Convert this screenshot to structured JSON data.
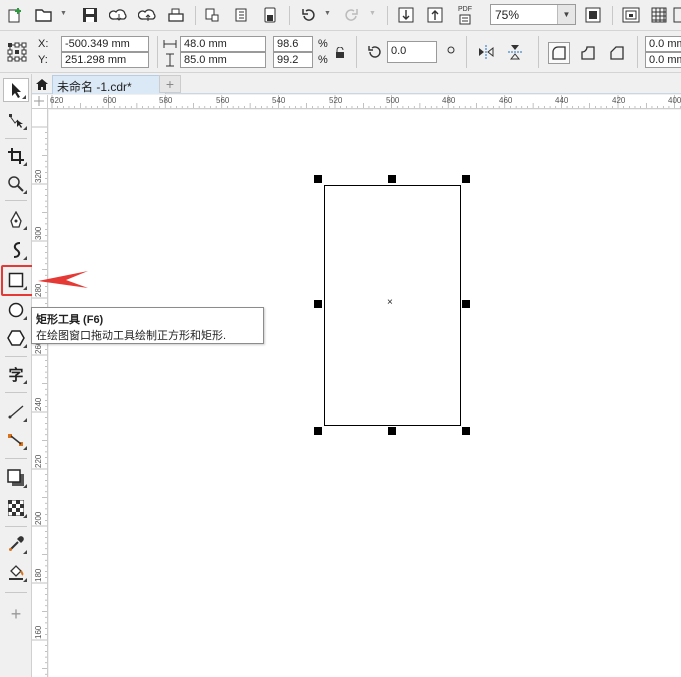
{
  "toolbar1": {
    "icons": [
      "new-document-icon",
      "open-folder-icon",
      "save-icon",
      "cloud-download-icon",
      "cloud-upload-icon",
      "print-icon",
      "import-icon",
      "export-icon",
      "publish-icon",
      "undo-icon",
      "redo-icon",
      "import-down-icon",
      "export-up-icon",
      "pdf-icon",
      "full-screen-icon",
      "snap-icon",
      "grid-icon"
    ],
    "pdf_label": "PDF",
    "zoom_value": "75%"
  },
  "propertybar": {
    "x_label": "X:",
    "y_label": "Y:",
    "x_value": "-500.349 mm",
    "y_value": "251.298 mm",
    "width_value": "48.0 mm",
    "height_value": "85.0 mm",
    "scale_x": "98.6",
    "scale_y": "99.2",
    "percent": "%",
    "rotation": "0.0",
    "corner1": "0.0 mm",
    "corner2": "0.0 mm"
  },
  "tab": {
    "title": "未命名 -1.cdr*",
    "add": "+"
  },
  "ruler": {
    "h_labels": [
      "620",
      "600",
      "580",
      "560",
      "540",
      "520",
      "500",
      "480",
      "460",
      "440",
      "420",
      "400"
    ],
    "v_labels": [
      "320",
      "300",
      "280",
      "260",
      "240",
      "220",
      "200",
      "180",
      "160",
      "140"
    ]
  },
  "tooltip": {
    "title": "矩形工具 (F6)",
    "desc": "在绘图窗口拖动工具绘制正方形和矩形."
  },
  "colors": {
    "highlight": "#e53935",
    "tab_bg": "#dbe8f5"
  }
}
